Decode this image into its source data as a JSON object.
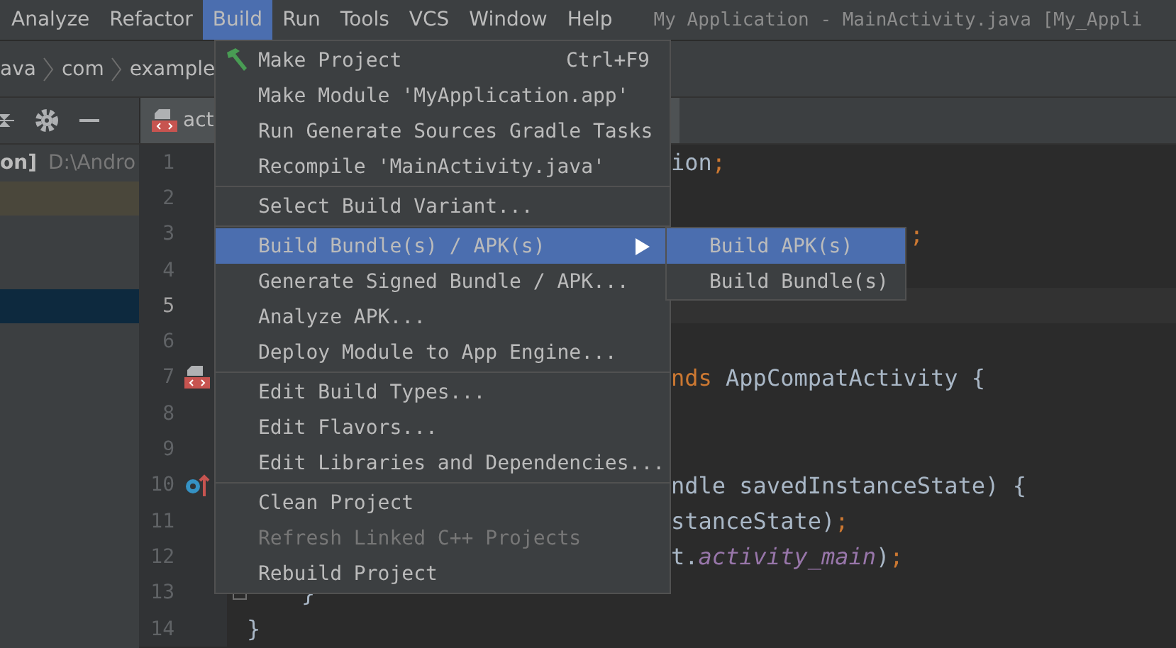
{
  "menubar": {
    "items": [
      {
        "label": "Analyze",
        "selected": false
      },
      {
        "label": "Refactor",
        "selected": false
      },
      {
        "label": "Build",
        "selected": true
      },
      {
        "label": "Run",
        "selected": false
      },
      {
        "label": "Tools",
        "selected": false
      },
      {
        "label": "VCS",
        "selected": false
      },
      {
        "label": "Window",
        "selected": false
      },
      {
        "label": "Help",
        "selected": false
      }
    ],
    "title": "My Application - MainActivity.java [My_Appli"
  },
  "breadcrumbs": [
    "ava",
    "com",
    "example"
  ],
  "editor_tab": {
    "label": "act"
  },
  "project_panel": {
    "name": "on]",
    "path": "D:\\Andro"
  },
  "code_lines": [
    {
      "number": "1",
      "kind": "plain",
      "current": false,
      "right": [
        {
          "text": "ion",
          "kind": "plain"
        },
        {
          "text": ";",
          "kind": "keyword"
        }
      ]
    },
    {
      "number": "2",
      "kind": "plain",
      "current": false
    },
    {
      "number": "3",
      "kind": "trailing",
      "current": false,
      "right": [
        {
          "text": ";",
          "kind": "keyword"
        }
      ]
    },
    {
      "number": "4",
      "kind": "plain",
      "current": false
    },
    {
      "number": "5",
      "kind": "plain",
      "current": true
    },
    {
      "number": "6",
      "kind": "plain",
      "current": false
    },
    {
      "number": "7",
      "kind": "layout_marker",
      "current": false,
      "right": [
        {
          "text": "nds",
          "kind": "keyword"
        },
        {
          "text": " AppCompatActivity {",
          "kind": "plain"
        }
      ]
    },
    {
      "number": "8",
      "kind": "plain",
      "current": false
    },
    {
      "number": "9",
      "kind": "plain",
      "current": false
    },
    {
      "number": "10",
      "kind": "override_marker",
      "current": false,
      "right": [
        {
          "text": "ndle savedInstanceState) {",
          "kind": "plain"
        }
      ]
    },
    {
      "number": "11",
      "kind": "plain",
      "current": false,
      "right": [
        {
          "text": "stanceState)",
          "kind": "plain"
        },
        {
          "text": ";",
          "kind": "keyword"
        }
      ]
    },
    {
      "number": "12",
      "kind": "plain",
      "current": false,
      "right": [
        {
          "text": "t.",
          "kind": "plain"
        },
        {
          "text": "activity_main",
          "kind": "field"
        },
        {
          "text": ")",
          "kind": "plain"
        },
        {
          "text": ";",
          "kind": "keyword"
        }
      ]
    },
    {
      "number": "13",
      "kind": "plain",
      "current": false,
      "fold": true,
      "left": "    }"
    },
    {
      "number": "14",
      "kind": "plain",
      "current": false,
      "left": "}"
    }
  ],
  "build_menu": {
    "groups": [
      [
        {
          "label": "Make Project",
          "kind": "action",
          "shortcut": "Ctrl+F9",
          "selected": false,
          "disabled": false
        },
        {
          "label": "Make Module 'MyApplication.app'",
          "kind": "action",
          "selected": false,
          "disabled": false
        },
        {
          "label": "Run Generate Sources Gradle Tasks",
          "kind": "action",
          "selected": false,
          "disabled": false
        },
        {
          "label": "Recompile 'MainActivity.java'",
          "kind": "action",
          "selected": false,
          "disabled": false
        }
      ],
      [
        {
          "label": "Select Build Variant...",
          "kind": "action",
          "selected": false,
          "disabled": false
        }
      ],
      [
        {
          "label": "Build Bundle(s) / APK(s)",
          "kind": "submenu",
          "selected": true,
          "disabled": false
        },
        {
          "label": "Generate Signed Bundle / APK...",
          "kind": "action",
          "selected": false,
          "disabled": false
        },
        {
          "label": "Analyze APK...",
          "kind": "action",
          "selected": false,
          "disabled": false
        },
        {
          "label": "Deploy Module to App Engine...",
          "kind": "action",
          "selected": false,
          "disabled": false
        }
      ],
      [
        {
          "label": "Edit Build Types...",
          "kind": "action",
          "selected": false,
          "disabled": false
        },
        {
          "label": "Edit Flavors...",
          "kind": "action",
          "selected": false,
          "disabled": false
        },
        {
          "label": "Edit Libraries and Dependencies...",
          "kind": "action",
          "selected": false,
          "disabled": false
        }
      ],
      [
        {
          "label": "Clean Project",
          "kind": "action",
          "selected": false,
          "disabled": false
        },
        {
          "label": "Refresh Linked C++ Projects",
          "kind": "action",
          "selected": false,
          "disabled": true
        },
        {
          "label": "Rebuild Project",
          "kind": "action",
          "selected": false,
          "disabled": false
        }
      ]
    ]
  },
  "submenu": {
    "items": [
      {
        "label": "Build APK(s)",
        "selected": true
      },
      {
        "label": "Build Bundle(s)",
        "selected": false
      }
    ]
  }
}
